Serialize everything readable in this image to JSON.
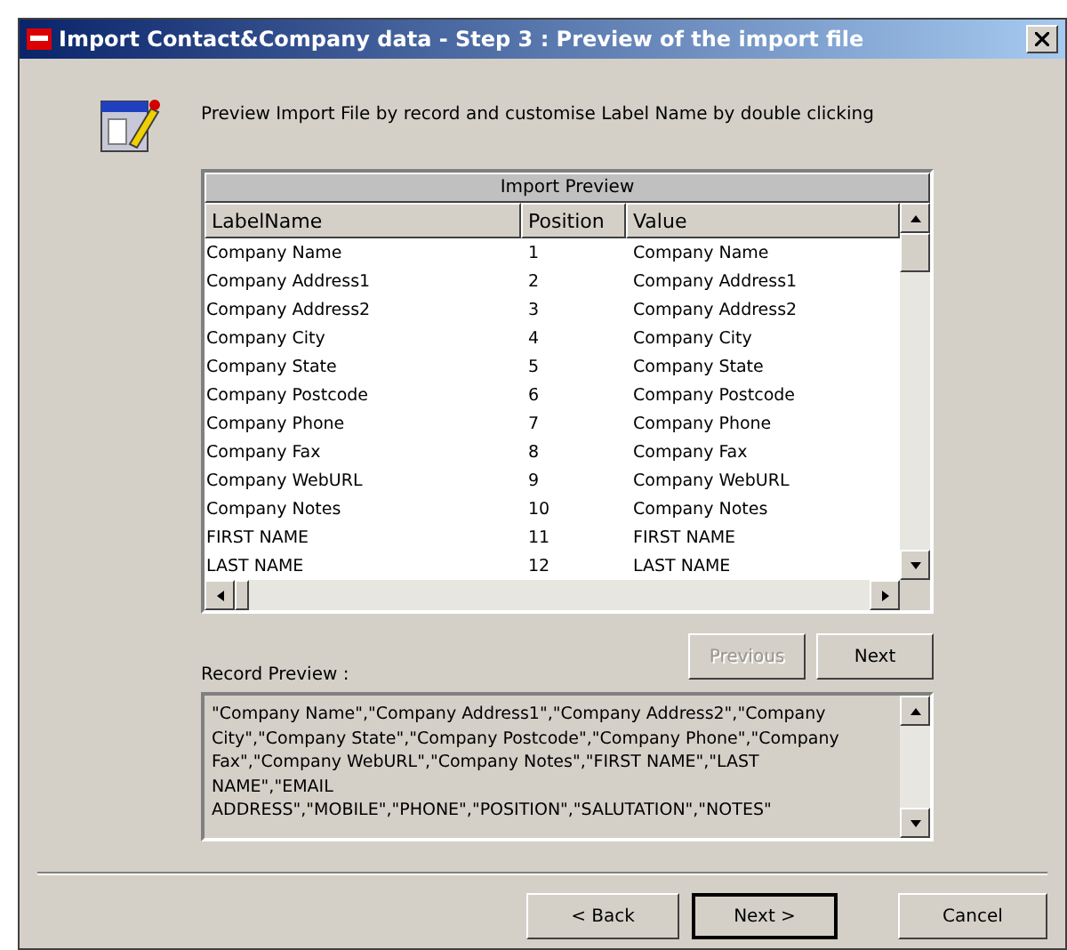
{
  "window": {
    "title": "Import Contact&Company data - Step 3 : Preview of the import file"
  },
  "instruction": "Preview Import File by record and customise Label Name by double clicking",
  "preview_table": {
    "title": "Import Preview",
    "columns": [
      "LabelName",
      "Position",
      "Value"
    ],
    "rows": [
      [
        "Company Name",
        "1",
        "Company Name"
      ],
      [
        "Company Address1",
        "2",
        "Company Address1"
      ],
      [
        "Company Address2",
        "3",
        "Company Address2"
      ],
      [
        "Company City",
        "4",
        "Company City"
      ],
      [
        "Company State",
        "5",
        "Company State"
      ],
      [
        "Company Postcode",
        "6",
        "Company Postcode"
      ],
      [
        "Company Phone",
        "7",
        "Company Phone"
      ],
      [
        "Company Fax",
        "8",
        "Company Fax"
      ],
      [
        "Company WebURL",
        "9",
        "Company WebURL"
      ],
      [
        "Company Notes",
        "10",
        "Company Notes"
      ],
      [
        "FIRST NAME",
        "11",
        "FIRST NAME"
      ],
      [
        "LAST NAME",
        "12",
        "LAST NAME"
      ]
    ]
  },
  "record_nav": [
    {
      "label": "Previous",
      "disabled": true
    },
    {
      "label": "Next",
      "disabled": false
    }
  ],
  "record_preview": {
    "label": "Record Preview :",
    "value": "\"Company Name\",\"Company Address1\",\"Company Address2\",\"Company\nCity\",\"Company State\",\"Company Postcode\",\"Company Phone\",\"Company\nFax\",\"Company WebURL\",\"Company Notes\",\"FIRST NAME\",\"LAST\nNAME\",\"EMAIL\nADDRESS\",\"MOBILE\",\"PHONE\",\"POSITION\",\"SALUTATION\",\"NOTES\""
  },
  "footer_buttons": [
    {
      "label": "< Back",
      "default": false
    },
    {
      "label": "Next >",
      "default": true
    },
    {
      "label": "Cancel",
      "default": false
    }
  ]
}
